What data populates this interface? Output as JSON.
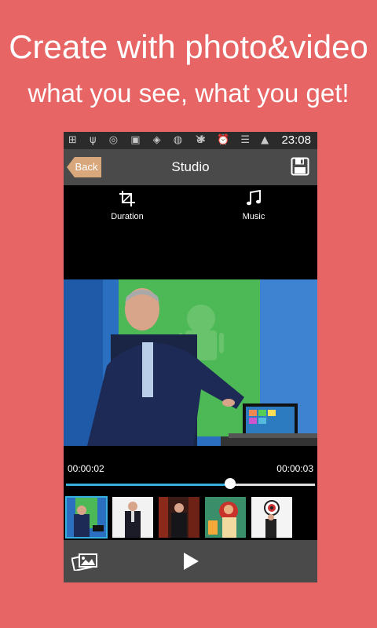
{
  "promo": {
    "headline": "Create with photo&video",
    "subheadline": "what you see, what you get!"
  },
  "statusbar": {
    "left_icons": "⊞ ψ ◎ ▣ ◈ ◍ ♉",
    "right_icons": "✱ ⏰ ☰ ▲",
    "time": "23:08"
  },
  "header": {
    "back_label": "Back",
    "title": "Studio"
  },
  "tools": {
    "duration_label": "Duration",
    "music_label": "Music"
  },
  "player": {
    "current_time": "00:00:02",
    "total_time": "00:00:03",
    "progress": 0.66
  },
  "thumbnails": [
    "clip-1",
    "clip-2",
    "clip-3",
    "clip-4",
    "clip-5"
  ],
  "colors": {
    "background": "#e86565",
    "bar": "#4a4a4a",
    "accent": "#35b0df",
    "back_button": "#d8a77b"
  }
}
